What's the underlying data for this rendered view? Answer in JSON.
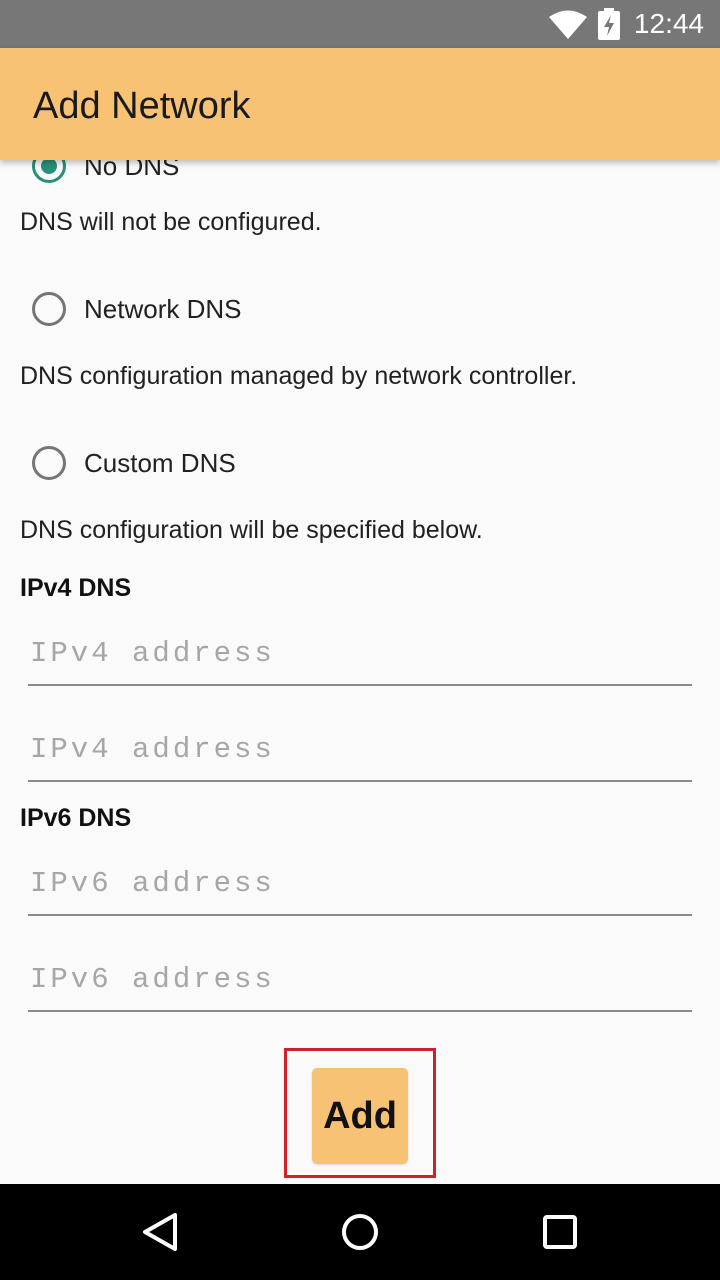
{
  "status_bar": {
    "time": "12:44",
    "icons": [
      "wifi-icon",
      "battery-charging-icon"
    ]
  },
  "app_bar": {
    "title": "Add Network"
  },
  "dns": {
    "options": [
      {
        "label": "No DNS",
        "description": "DNS will not be configured.",
        "checked": true
      },
      {
        "label": "Network DNS",
        "description": "DNS configuration managed by network controller.",
        "checked": false
      },
      {
        "label": "Custom DNS",
        "description": "DNS configuration will be specified below.",
        "checked": false
      }
    ]
  },
  "ipv4": {
    "title": "IPv4 DNS",
    "fields": [
      {
        "placeholder": "IPv4 address",
        "value": ""
      },
      {
        "placeholder": "IPv4 address",
        "value": ""
      }
    ]
  },
  "ipv6": {
    "title": "IPv6 DNS",
    "fields": [
      {
        "placeholder": "IPv6 address",
        "value": ""
      },
      {
        "placeholder": "IPv6 address",
        "value": ""
      }
    ]
  },
  "actions": {
    "add_label": "Add"
  },
  "nav_bar": {
    "icons": [
      "back-icon",
      "home-icon",
      "recents-icon"
    ]
  },
  "colors": {
    "accent": "#f8c275",
    "radio_checked": "#2a8f7a",
    "highlight": "#d0202a"
  }
}
